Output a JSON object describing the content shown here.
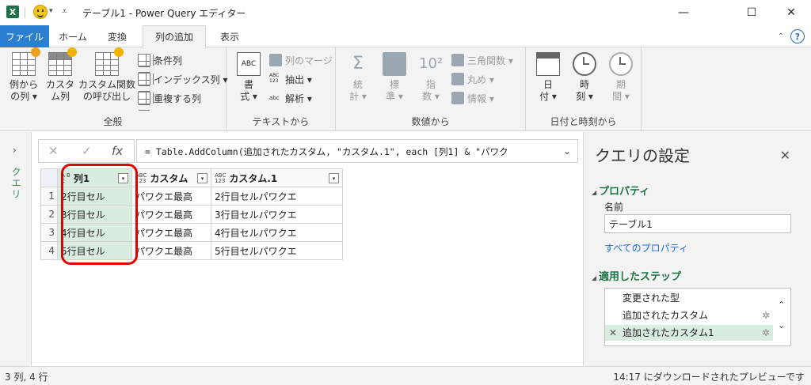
{
  "window": {
    "title": "テーブル1 - Power Query エディター",
    "logo": "X",
    "minimize": "—",
    "maximize": "☐",
    "close": "✕"
  },
  "tabs": {
    "file": "ファイル",
    "home": "ホーム",
    "transform": "変換",
    "add_column": "列の追加",
    "view": "表示",
    "active": "列の追加"
  },
  "ribbon": {
    "general": {
      "label": "全般",
      "column_from_examples": "例から\nの列 ▾",
      "custom_column": "カスタ\nム列",
      "invoke_custom_function": "カスタム関数\nの呼び出し",
      "conditional_column": "条件列",
      "index_column": "インデックス列 ▾",
      "duplicate_column": "重複する列"
    },
    "text": {
      "label": "テキストから",
      "format": "書\n式 ▾",
      "merge_columns": "列のマージ",
      "extract": "抽出 ▾",
      "parse": "解析 ▾"
    },
    "number": {
      "label": "数値から",
      "statistics": "統\n計 ▾",
      "standard": "標\n準 ▾",
      "scientific": "指\n数 ▾",
      "trigonometry": "三角関数 ▾",
      "rounding": "丸め ▾",
      "information": "情報 ▾"
    },
    "datetime": {
      "label": "日付と時刻から",
      "date": "日\n付 ▾",
      "time": "時\n刻 ▾",
      "duration": "期\n間 ▾"
    }
  },
  "leftnav": {
    "label": "クエリ",
    "expand": "›"
  },
  "formula": {
    "cancel": "✕",
    "confirm": "✓",
    "fx": "fx",
    "text": "= Table.AddColumn(追加されたカスタム, \"カスタム.1\", each [列1] & \"パワク",
    "expand": "⌄"
  },
  "grid": {
    "columns": [
      {
        "type_top": "A B",
        "type_bottom": "C",
        "name": "列1"
      },
      {
        "type_top": "ABC",
        "type_bottom": "123",
        "name": "カスタム"
      },
      {
        "type_top": "ABC",
        "type_bottom": "123",
        "name": "カスタム.1"
      }
    ],
    "rows": [
      {
        "num": "1",
        "c1": "2行目セル",
        "c2": "パワクエ最高",
        "c3": "2行目セルパワクエ"
      },
      {
        "num": "2",
        "c1": "3行目セル",
        "c2": "パワクエ最高",
        "c3": "3行目セルパワクエ"
      },
      {
        "num": "3",
        "c1": "4行目セル",
        "c2": "パワクエ最高",
        "c3": "4行目セルパワクエ"
      },
      {
        "num": "4",
        "c1": "5行目セル",
        "c2": "パワクエ最高",
        "c3": "5行目セルパワクエ"
      }
    ]
  },
  "query_settings": {
    "title": "クエリの設定",
    "close": "✕",
    "properties_header": "プロパティ",
    "name_label": "名前",
    "name_value": "テーブル1",
    "all_properties": "すべてのプロパティ",
    "applied_steps_header": "適用したステップ",
    "steps": [
      {
        "label": "変更された型"
      },
      {
        "label": "追加されたカスタム"
      },
      {
        "label": "追加されたカスタム1"
      }
    ]
  },
  "status": {
    "left": "3 列, 4 行",
    "right": "14:17 にダウンロードされたプレビューです"
  },
  "colors": {
    "accent": "#2b7fd0",
    "excel_green": "#1e7145",
    "highlight_red": "#e00000",
    "selected_green": "#d8ecdf"
  }
}
